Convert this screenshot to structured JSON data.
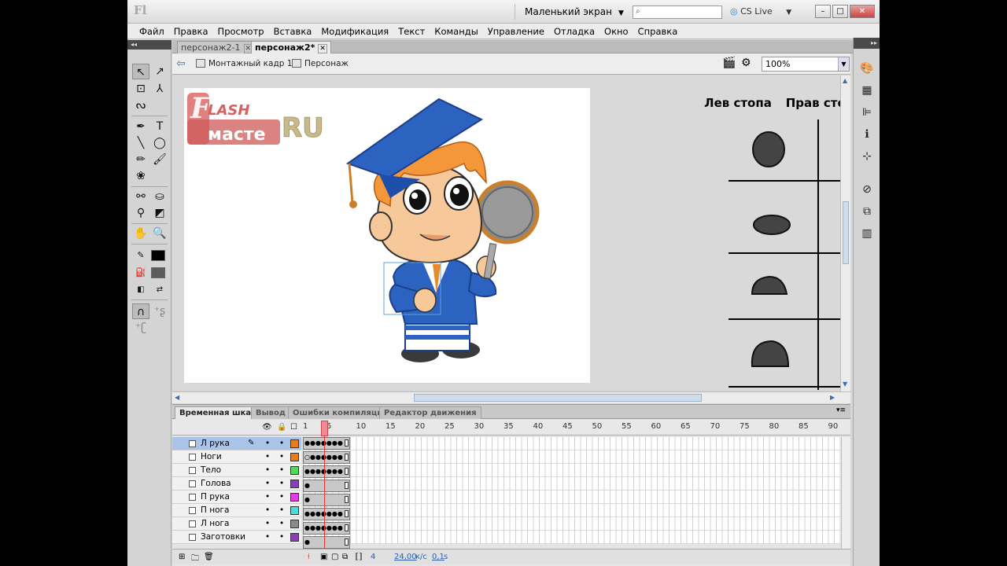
{
  "titlebar": {
    "app_icon": "Fl",
    "workspace": "Маленький экран",
    "search_placeholder": "",
    "cslive": "CS Live",
    "colors": {
      "accent": "#2a7bc4",
      "close": "#c44444"
    }
  },
  "menu": [
    "Файл",
    "Правка",
    "Просмотр",
    "Вставка",
    "Модификация",
    "Текст",
    "Команды",
    "Управление",
    "Отладка",
    "Окно",
    "Справка"
  ],
  "doc_tabs": [
    {
      "label": "персонаж2-1",
      "active": false
    },
    {
      "label": "персонаж2*",
      "active": true
    }
  ],
  "editbar": {
    "scene": "Монтажный кадр 1",
    "symbol": "Персонаж",
    "zoom": "100%"
  },
  "stage": {
    "logo_top": "LASH",
    "logo_bottom": "масте",
    "logo_ru": "RU",
    "header_left": "Лев стопа",
    "header_right": "Прав стопа"
  },
  "timeline": {
    "tabs": [
      "Временная шкала",
      "Вывод",
      "Ошибки компиляции",
      "Редактор движения"
    ],
    "ruler": [
      "1",
      "5",
      "10",
      "15",
      "20",
      "25",
      "30",
      "35",
      "40",
      "45",
      "50",
      "55",
      "60",
      "65",
      "70",
      "75",
      "80",
      "85",
      "90"
    ],
    "layers": [
      {
        "name": "Л рука",
        "color": "#e87c1e",
        "selected": true,
        "keys": "●●●●●●●"
      },
      {
        "name": "Ноги",
        "color": "#e87c1e",
        "selected": false,
        "keys": "○●●●●●●"
      },
      {
        "name": "Тело",
        "color": "#56d856",
        "selected": false,
        "keys": "●●●●●●●"
      },
      {
        "name": "Голова",
        "color": "#8a3fb5",
        "selected": false,
        "keys": "●"
      },
      {
        "name": "П рука",
        "color": "#e040e0",
        "selected": false,
        "keys": "●"
      },
      {
        "name": "П нога",
        "color": "#4fd8d8",
        "selected": false,
        "keys": "●●●●●●●"
      },
      {
        "name": "Л нога",
        "color": "#8a8a8a",
        "selected": false,
        "keys": "●●●●●●●"
      },
      {
        "name": "Заготовки",
        "color": "#8a3fb5",
        "selected": false,
        "keys": "●"
      }
    ],
    "current_frame": "4",
    "fps": "24,00",
    "fps_unit": "к/с",
    "time": "0,1",
    "time_unit": "s"
  }
}
